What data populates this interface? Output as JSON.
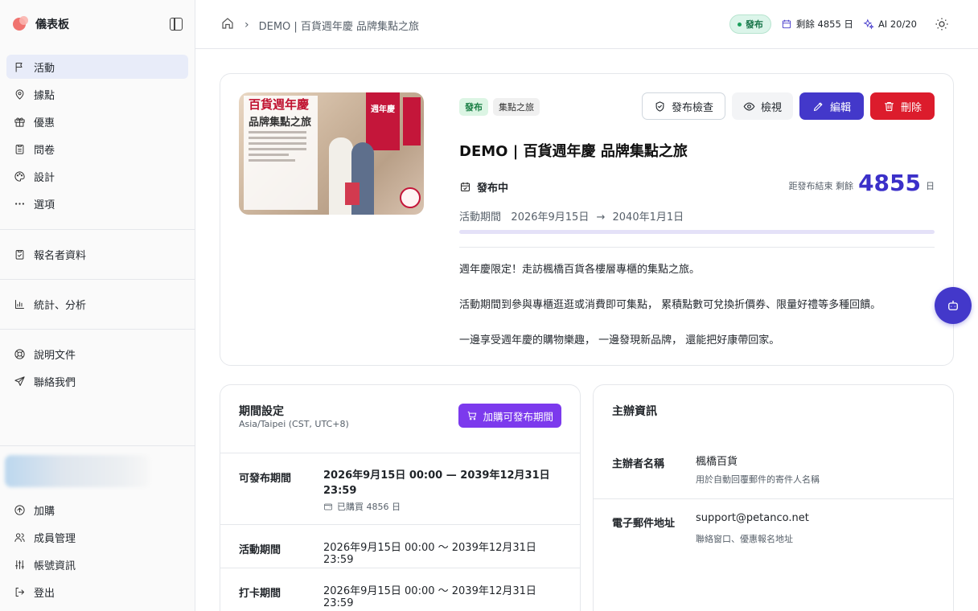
{
  "sidebar": {
    "brand": "儀表板",
    "nav_main": [
      {
        "label": "活動",
        "icon": "flag-icon",
        "active": true
      },
      {
        "label": "據點",
        "icon": "map-pin-icon"
      },
      {
        "label": "優惠",
        "icon": "gift-icon"
      },
      {
        "label": "問卷",
        "icon": "clipboard-icon"
      },
      {
        "label": "設計",
        "icon": "palette-icon"
      },
      {
        "label": "選項",
        "icon": "more-icon"
      }
    ],
    "nav_registrants": "報名者資料",
    "nav_stats": "統計、分析",
    "nav_help": [
      {
        "label": "說明文件",
        "icon": "lifebuoy-icon"
      },
      {
        "label": "聯絡我們",
        "icon": "send-icon"
      }
    ],
    "nav_bottom": [
      {
        "label": "加購",
        "icon": "arrow-up-circle-icon"
      },
      {
        "label": "成員管理",
        "icon": "users-icon"
      },
      {
        "label": "帳號資訊",
        "icon": "sliders-icon"
      },
      {
        "label": "登出",
        "icon": "logout-icon"
      }
    ]
  },
  "topbar": {
    "breadcrumb": "DEMO | 百貨週年慶 品牌集點之旅",
    "status": "發布",
    "remaining": "剩餘 4855 日",
    "ai_quota": "AI 20/20"
  },
  "hero": {
    "poster": {
      "title1": "百貨週年慶",
      "title2": "品牌集點之旅",
      "banner": "週年慶"
    },
    "tags": [
      "發布",
      "集點之旅"
    ],
    "actions": {
      "check": "發布檢查",
      "view": "檢視",
      "edit": "編輯",
      "delete": "刪除"
    },
    "title": "DEMO | 百貨週年慶 品牌集點之旅",
    "status": "發布中",
    "remain_prefix": "距發布結束 剩餘",
    "remain_days": "4855",
    "remain_unit": "日",
    "period_label": "活動期間",
    "period_start": "2026年9月15日",
    "period_end": "2040年1月1日",
    "progress": 0.0,
    "description": [
      "週年慶限定！走訪楓橋百貨各樓層專櫃的集點之旅。",
      "活動期間到參與專櫃逛逛或消費即可集點， 累積點數可兌換折價券、限量好禮等多種回饋。",
      "一邊享受週年慶的購物樂趣， 一邊發現新品牌， 還能把好康帶回家。"
    ]
  },
  "period_card": {
    "title": "期間設定",
    "timezone": "Asia/Taipei (CST, UTC+8)",
    "buy_button": "加購可發布期間",
    "rows": [
      {
        "label": "可發布期間",
        "value": "2026年9月15日 00:00 — 2039年12月31日 23:59",
        "sub": "已購買 4856 日"
      },
      {
        "label": "活動期間",
        "value": "2026年9月15日 00:00 〜 2039年12月31日 23:59"
      },
      {
        "label": "打卡期間",
        "value": "2026年9月15日 00:00 〜 2039年12月31日 23:59"
      }
    ]
  },
  "org_card": {
    "title": "主辦資訊",
    "rows": [
      {
        "label": "主辦者名稱",
        "value": "楓橋百貨",
        "hint": "用於自動回覆郵件的寄件人名稱"
      },
      {
        "label": "電子郵件地址",
        "value": "support@petanco.net",
        "hint": "聯絡窗口、優惠報名地址"
      }
    ]
  },
  "colors": {
    "accent": "#4338ca",
    "danger": "#dc1c2c",
    "purple": "#7c3aed",
    "success": "#1a9f5b"
  }
}
